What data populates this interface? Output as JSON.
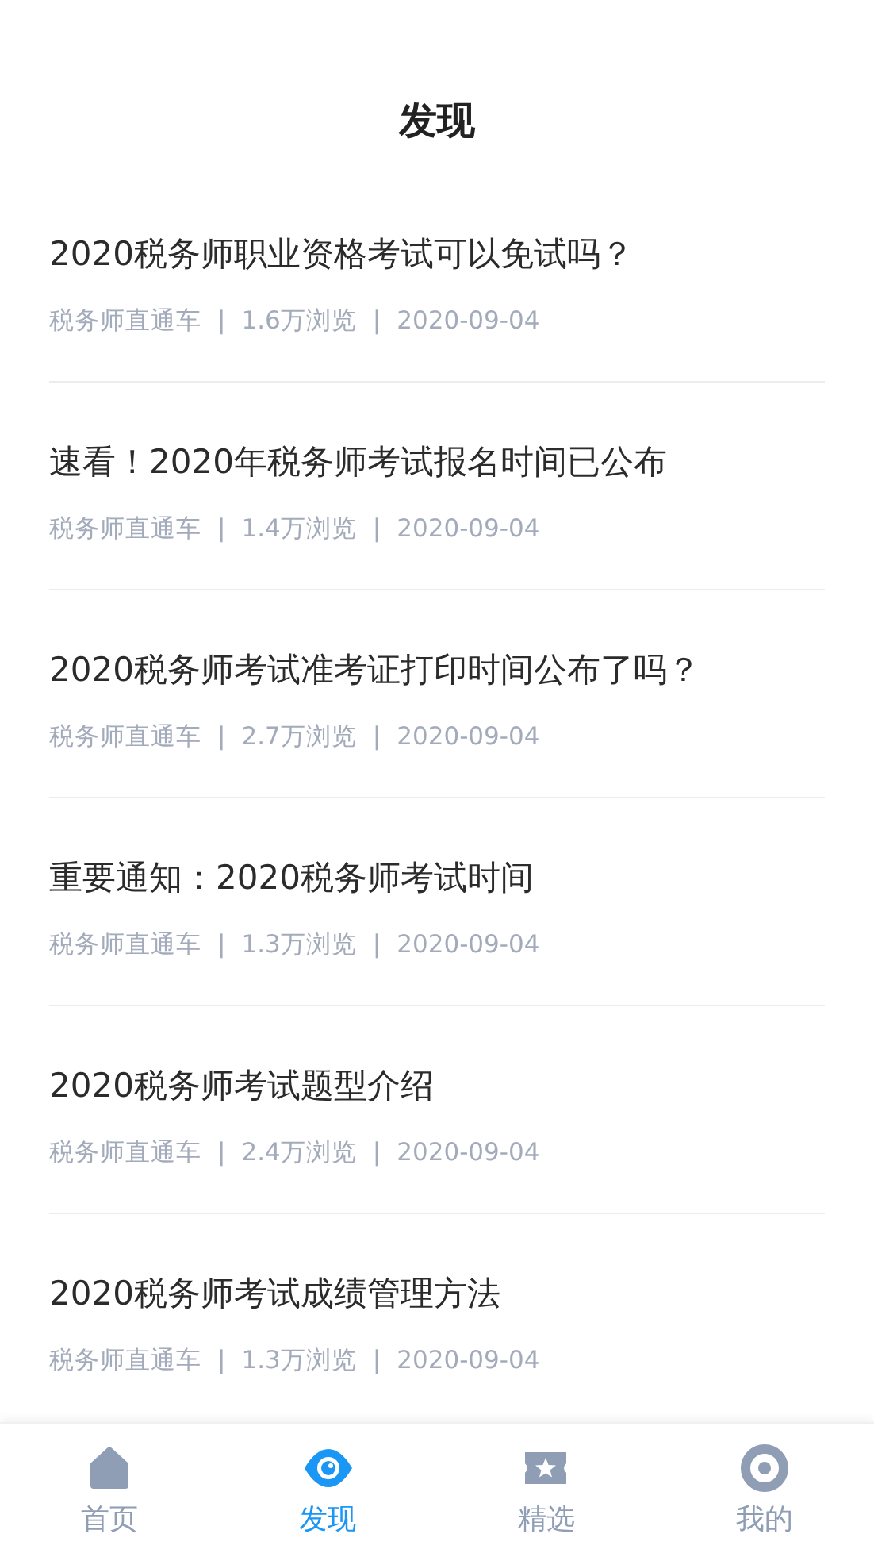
{
  "header": {
    "title": "发现"
  },
  "articles": [
    {
      "title": "2020税务师职业资格考试可以免试吗？",
      "meta": [
        "税务师直通车",
        "|",
        "1.6万浏览",
        "|",
        "2020-09-04"
      ]
    },
    {
      "title": "速看！2020年税务师考试报名时间已公布",
      "meta": [
        "税务师直通车",
        "|",
        "1.4万浏览",
        "|",
        "2020-09-04"
      ]
    },
    {
      "title": "2020税务师考试准考证打印时间公布了吗？",
      "meta": [
        "税务师直通车",
        "|",
        "2.7万浏览",
        "|",
        "2020-09-04"
      ]
    },
    {
      "title": "重要通知：2020税务师考试时间",
      "meta": [
        "税务师直通车",
        "|",
        "1.3万浏览",
        "|",
        "2020-09-04"
      ]
    },
    {
      "title": "2020税务师考试题型介绍",
      "meta": [
        "税务师直通车",
        "|",
        "2.4万浏览",
        "|",
        "2020-09-04"
      ]
    },
    {
      "title": "2020税务师考试成绩管理方法",
      "meta": [
        "税务师直通车",
        "|",
        "1.3万浏览",
        "|",
        "2020-09-04"
      ]
    }
  ],
  "tab_bar": [
    {
      "kind": "home",
      "label": "首页",
      "selected": false
    },
    {
      "kind": "discover",
      "label": "发现",
      "selected": true
    },
    {
      "kind": "featured",
      "label": "精选",
      "selected": false
    },
    {
      "kind": "profile",
      "label": "我的",
      "selected": false
    }
  ]
}
